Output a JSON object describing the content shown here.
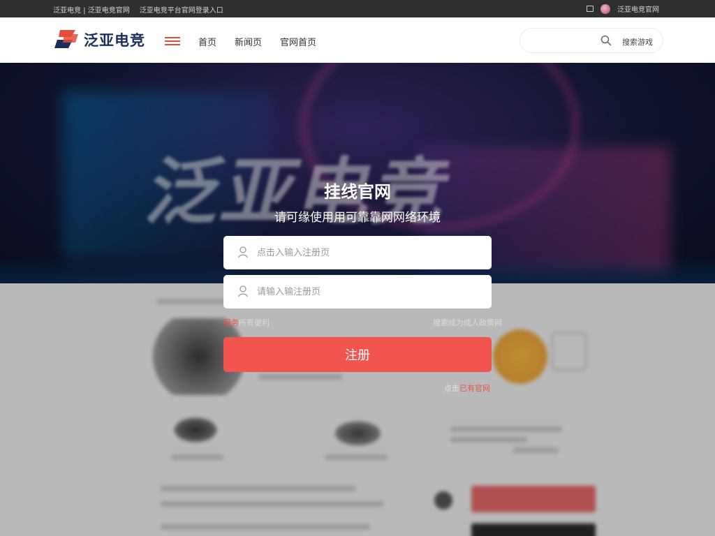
{
  "topbar": {
    "left_text_1": "泛亚电竞 | 泛亚电竞官网",
    "left_text_2": "泛亚电竞平台官网登录入口",
    "right_text": "泛亚电竞官网"
  },
  "header": {
    "logo_text": "泛亚电竞",
    "nav": [
      "首页",
      "新闻页",
      "官网首页"
    ],
    "search_label": "搜索游戏"
  },
  "hero": {
    "bg_text": "泛亚电竞"
  },
  "form": {
    "title": "挂线官网",
    "subtitle": "请可缘使用用可靠靠网网络环境",
    "field1_placeholder": "点击入输入注册页",
    "field2_placeholder": "请输入输注册页",
    "aux_left_highlight": "服务",
    "aux_left_text": "所有便利",
    "aux_right": "搜索成为成人政策网",
    "submit_label": "注册",
    "bottom_text": "点击",
    "bottom_link": "已有官网"
  },
  "colors": {
    "accent": "#f25450",
    "brand_navy": "#1c2f5c",
    "brand_red": "#e84b3c"
  }
}
